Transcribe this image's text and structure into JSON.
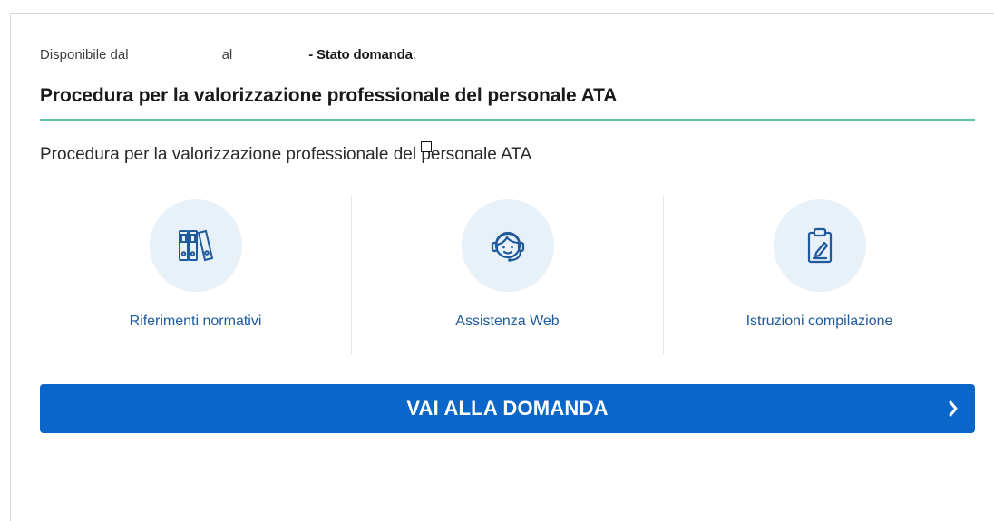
{
  "header": {
    "available_from_label": "Disponibile dal",
    "to_label": "al",
    "status_label": "- Stato domanda",
    "status_colon": ":"
  },
  "procedure": {
    "title": "Procedura per la valorizzazione professionale del personale ATA",
    "description": "Procedura per la valorizzazione professionale del personale ATA"
  },
  "links": [
    {
      "label": "Riferimenti normativi",
      "icon": "binders-icon"
    },
    {
      "label": "Assistenza Web",
      "icon": "headset-support-icon"
    },
    {
      "label": "Istruzioni compilazione",
      "icon": "clipboard-edit-icon"
    }
  ],
  "cta": {
    "label": "VAI ALLA DOMANDA",
    "icon": "chevron-right-icon"
  },
  "colors": {
    "accent_rule": "#5bc1a8",
    "primary_button": "#0a66c8",
    "link_text": "#1f5a9c",
    "icon_circle": "#e8f0f8",
    "icon_stroke": "#1f5a9c"
  }
}
